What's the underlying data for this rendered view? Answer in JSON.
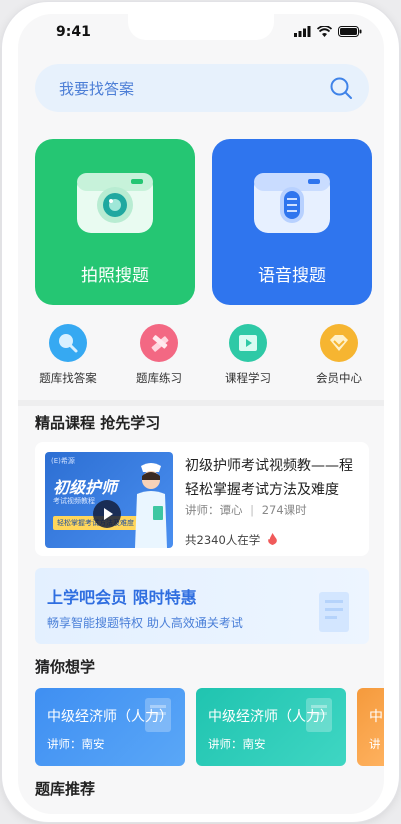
{
  "status_bar": {
    "time": "9:41"
  },
  "search": {
    "placeholder": "我要找答案"
  },
  "main_actions": [
    {
      "label": "拍照搜题",
      "color": "#25c673"
    },
    {
      "label": "语音搜题",
      "color": "#2f75ee"
    }
  ],
  "shortcuts": [
    {
      "label": "题库找答案",
      "icon": "search-icon",
      "color": "#36a9f2"
    },
    {
      "label": "题库练习",
      "icon": "pencil-ruler-icon",
      "color": "#f36883"
    },
    {
      "label": "课程学习",
      "icon": "video-play-icon",
      "color": "#2ec9a6"
    },
    {
      "label": "会员中心",
      "icon": "diamond-icon",
      "color": "#f6b531"
    }
  ],
  "featured": {
    "title": "精品课程  抢先学习",
    "course": {
      "thumb_brand": "(E)希源",
      "thumb_title": "初级护师",
      "thumb_subtitle": "考试视频教程",
      "thumb_tag": "轻松掌握考试方法及难度",
      "title": "初级护师考试视频教——程轻松掌握考试方法及难度",
      "teacher": "讲师：谭心",
      "separator": "|",
      "hours": "274课时",
      "learners": "共2340人在学"
    }
  },
  "member_banner": {
    "title": "上学吧会员  限时特惠",
    "subtitle": "畅享智能搜题特权   助人高效通关考试"
  },
  "guess": {
    "title": "猜你想学",
    "cards": [
      {
        "title": "中级经济师（人力）",
        "teacher": "讲师：南安"
      },
      {
        "title": "中级经济师（人力）",
        "teacher": "讲师：南安"
      },
      {
        "title": "中",
        "teacher": "讲"
      }
    ]
  },
  "question_bank": {
    "title": "题库推荐"
  }
}
